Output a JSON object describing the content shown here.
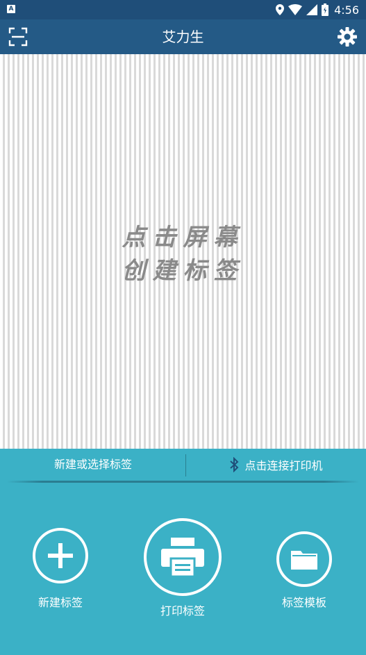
{
  "status_bar": {
    "notification_icon": "A",
    "time": "4:56"
  },
  "app_bar": {
    "title": "艾力生"
  },
  "canvas": {
    "hint_line1": "点击屏幕",
    "hint_line2": "创建标签"
  },
  "action_bar": {
    "new_or_select_label": "新建或选择标签",
    "connect_printer_label": "点击连接打印机"
  },
  "bottom_buttons": [
    {
      "label": "新建标签",
      "icon": "plus-icon"
    },
    {
      "label": "打印标签",
      "icon": "printer-icon"
    },
    {
      "label": "标签模板",
      "icon": "folder-icon"
    }
  ],
  "colors": {
    "status_bar": "#1f4e79",
    "app_bar": "#245a86",
    "panel": "#3bb1c6"
  }
}
